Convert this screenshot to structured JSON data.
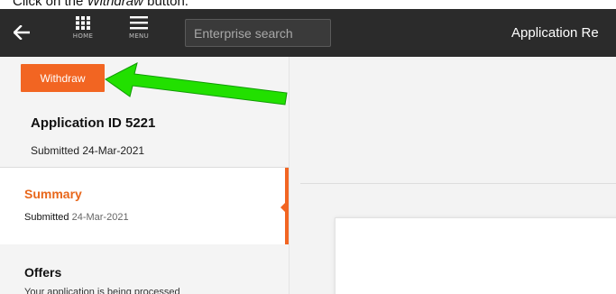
{
  "instruction": {
    "prefix": "Click on the ",
    "target": "Withdraw",
    "suffix": " button."
  },
  "topbar": {
    "home_label": "HOME",
    "menu_label": "MENU",
    "search_placeholder": "Enterprise search",
    "app_title": "Application Re"
  },
  "application": {
    "withdraw_label": "Withdraw",
    "id_label": "Application ID 5221",
    "submitted_label": "Submitted 24-Mar-2021"
  },
  "sidebar": {
    "summary": {
      "title": "Summary",
      "meta_prefix": "Submitted",
      "meta_date": "24-Mar-2021"
    },
    "offers": {
      "title": "Offers",
      "meta": "Your application is being processed"
    }
  },
  "colors": {
    "accent": "#f26522",
    "arrow": "#22e000",
    "topbar": "#2b2b2b"
  },
  "icons": [
    "back-arrow-icon",
    "home-grid-icon",
    "menu-icon"
  ]
}
